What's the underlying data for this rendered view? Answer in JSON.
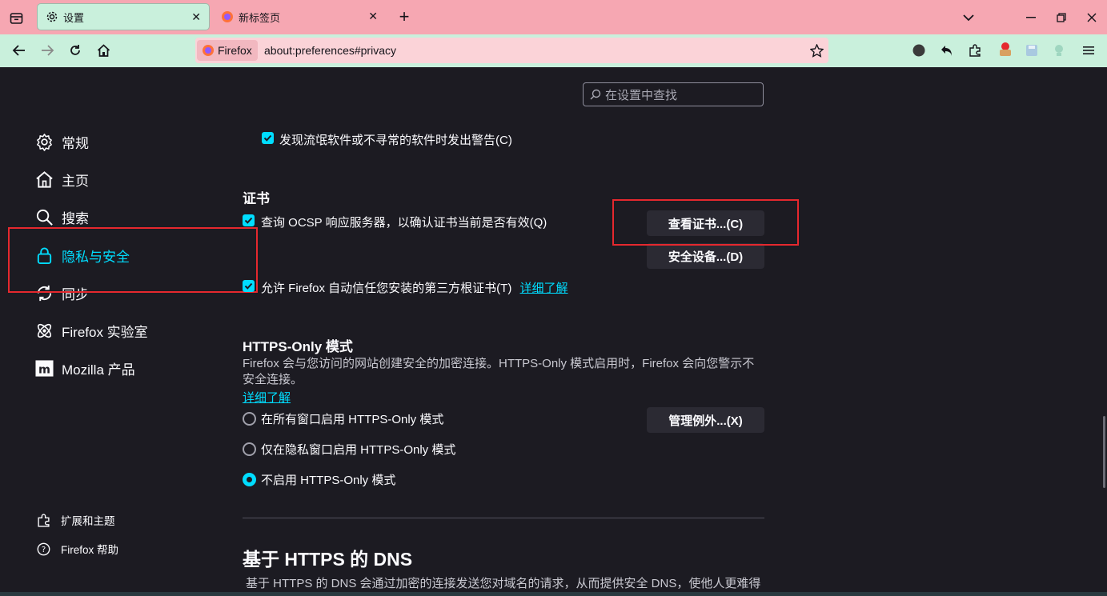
{
  "tabs": [
    {
      "title": "设置",
      "icon": "gear-icon",
      "active": true
    },
    {
      "title": "新标签页",
      "icon": "firefox-logo-icon",
      "active": false
    }
  ],
  "navbar": {
    "identity_label": "Firefox",
    "url": "about:preferences#privacy"
  },
  "search": {
    "placeholder": "在设置中查找"
  },
  "sidebar": {
    "items": [
      {
        "label": "常规",
        "icon": "gear-icon"
      },
      {
        "label": "主页",
        "icon": "home-icon"
      },
      {
        "label": "搜索",
        "icon": "search-icon"
      },
      {
        "label": "隐私与安全",
        "icon": "lock-icon",
        "selected": true
      },
      {
        "label": "同步",
        "icon": "sync-icon"
      },
      {
        "label": "Firefox 实验室",
        "icon": "labs-icon"
      },
      {
        "label": "Mozilla 产品",
        "icon": "mozilla-icon"
      }
    ],
    "footer": [
      {
        "label": "扩展和主题",
        "icon": "puzzle-icon"
      },
      {
        "label": "Firefox 帮助",
        "icon": "help-icon"
      }
    ]
  },
  "main": {
    "unwanted_software_checkbox": "发现流氓软件或不寻常的软件时发出警告(C)",
    "certificates": {
      "heading": "证书",
      "ocsp_checkbox": "查询 OCSP 响应服务器，以确认证书当前是否有效(Q)",
      "view_certs_button": "查看证书...(C)",
      "security_devices_button": "安全设备...(D)",
      "third_party_checkbox": "允许 Firefox 自动信任您安装的第三方根证书(T)",
      "learn_more": "详细了解"
    },
    "https_only": {
      "heading": "HTTPS-Only 模式",
      "description": "Firefox 会与您访问的网站创建安全的加密连接。HTTPS-Only 模式启用时，Firefox 会向您警示不安全连接。",
      "learn_more": "详细了解",
      "options": [
        {
          "label": "在所有窗口启用 HTTPS-Only 模式",
          "selected": false
        },
        {
          "label": "仅在隐私窗口启用 HTTPS-Only 模式",
          "selected": false
        },
        {
          "label": "不启用 HTTPS-Only 模式",
          "selected": true
        }
      ],
      "manage_exceptions_button": "管理例外...(X)"
    },
    "dns": {
      "heading": "基于 HTTPS 的 DNS",
      "description": "基于 HTTPS 的 DNS 会通过加密的连接发送您对域名的请求，从而提供安全 DNS，使他人更难得"
    }
  },
  "colors": {
    "accent": "#00ddff",
    "background": "#1c1b22",
    "tabstrip": "#f6a7b2",
    "navbar": "#c9f0dc",
    "highlight_box": "#e5282e"
  }
}
